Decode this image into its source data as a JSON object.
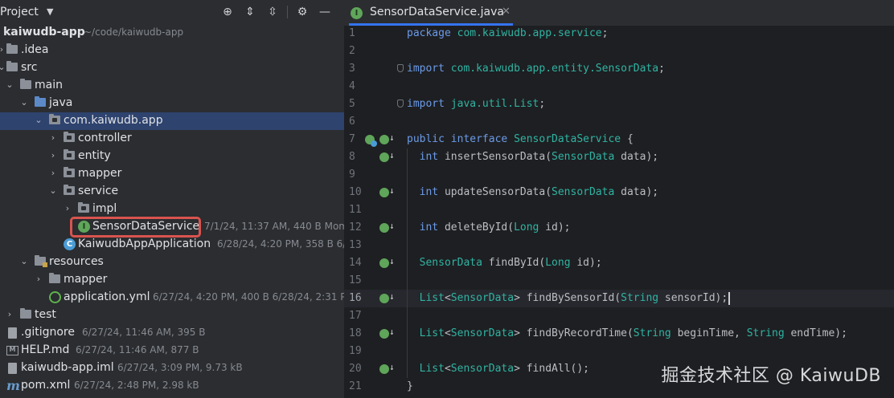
{
  "project_panel": {
    "title": "Project",
    "tree": [
      {
        "name": "kaiwudb-app",
        "meta": "~/code/kaiwudb-app"
      },
      {
        "name": ".idea"
      },
      {
        "name": "src"
      },
      {
        "name": "main"
      },
      {
        "name": "java"
      },
      {
        "name": "com.kaiwudb.app"
      },
      {
        "name": "controller"
      },
      {
        "name": "entity"
      },
      {
        "name": "mapper"
      },
      {
        "name": "service"
      },
      {
        "name": "impl"
      },
      {
        "name": "SensorDataService",
        "meta": "7/1/24, 11:37 AM, 440 B Mome"
      },
      {
        "name": "KaiwudbAppApplication",
        "meta": "6/28/24, 4:20 PM, 358 B 6/2"
      },
      {
        "name": "resources"
      },
      {
        "name": "mapper"
      },
      {
        "name": "application.yml",
        "meta": "6/27/24, 4:20 PM, 400 B 6/28/24, 2:31 PM"
      },
      {
        "name": "test"
      },
      {
        "name": ".gitignore",
        "meta": "6/27/24, 11:46 AM, 395 B"
      },
      {
        "name": "HELP.md",
        "meta": "6/27/24, 11:46 AM, 877 B"
      },
      {
        "name": "kaiwudb-app.iml",
        "meta": "6/27/24, 3:09 PM, 9.73 kB"
      },
      {
        "name": "pom.xml",
        "meta": "6/27/24, 2:48 PM, 2.98 kB"
      }
    ]
  },
  "editor": {
    "tab_label": "SensorDataService.java",
    "current_line": 16,
    "lines": [
      {
        "n": "1",
        "tokens": [
          [
            "kw",
            "package "
          ],
          [
            "ty",
            "com.kaiwudb.app.service"
          ],
          [
            "pl",
            ";"
          ]
        ]
      },
      {
        "n": "2",
        "tokens": []
      },
      {
        "n": "3",
        "tokens": [
          [
            "kw",
            "import "
          ],
          [
            "ty",
            "com.kaiwudb.app.entity.SensorData"
          ],
          [
            "pl",
            ";"
          ]
        ]
      },
      {
        "n": "4",
        "tokens": []
      },
      {
        "n": "5",
        "tokens": [
          [
            "kw",
            "import "
          ],
          [
            "ty",
            "java.util.List"
          ],
          [
            "pl",
            ";"
          ]
        ]
      },
      {
        "n": "6",
        "tokens": []
      },
      {
        "n": "7",
        "tokens": [
          [
            "kw",
            "public interface "
          ],
          [
            "ty",
            "SensorDataService"
          ],
          [
            "pl",
            " {"
          ]
        ]
      },
      {
        "n": "8",
        "tokens": [
          [
            "pl",
            "  "
          ],
          [
            "kw",
            "int "
          ],
          [
            "pl",
            "insertSensorData("
          ],
          [
            "ty",
            "SensorData"
          ],
          [
            "pl",
            " data);"
          ]
        ]
      },
      {
        "n": "9",
        "tokens": []
      },
      {
        "n": "10",
        "tokens": [
          [
            "pl",
            "  "
          ],
          [
            "kw",
            "int "
          ],
          [
            "pl",
            "updateSensorData("
          ],
          [
            "ty",
            "SensorData"
          ],
          [
            "pl",
            " data);"
          ]
        ]
      },
      {
        "n": "11",
        "tokens": []
      },
      {
        "n": "12",
        "tokens": [
          [
            "pl",
            "  "
          ],
          [
            "kw",
            "int "
          ],
          [
            "pl",
            "deleteById("
          ],
          [
            "ty",
            "Long"
          ],
          [
            "pl",
            " id);"
          ]
        ]
      },
      {
        "n": "13",
        "tokens": []
      },
      {
        "n": "14",
        "tokens": [
          [
            "pl",
            "  "
          ],
          [
            "ty",
            "SensorData"
          ],
          [
            "pl",
            " findById("
          ],
          [
            "ty",
            "Long"
          ],
          [
            "pl",
            " id);"
          ]
        ]
      },
      {
        "n": "15",
        "tokens": []
      },
      {
        "n": "16",
        "tokens": [
          [
            "pl",
            "  "
          ],
          [
            "ty",
            "List"
          ],
          [
            "pl",
            "<"
          ],
          [
            "ty",
            "SensorData"
          ],
          [
            "pl",
            "> findBySensorId("
          ],
          [
            "ty",
            "String"
          ],
          [
            "pl",
            " sensorId);"
          ]
        ]
      },
      {
        "n": "17",
        "tokens": []
      },
      {
        "n": "18",
        "tokens": [
          [
            "pl",
            "  "
          ],
          [
            "ty",
            "List"
          ],
          [
            "pl",
            "<"
          ],
          [
            "ty",
            "SensorData"
          ],
          [
            "pl",
            "> findByRecordTime("
          ],
          [
            "ty",
            "String"
          ],
          [
            "pl",
            " beginTime, "
          ],
          [
            "ty",
            "String"
          ],
          [
            "pl",
            " endTime);"
          ]
        ]
      },
      {
        "n": "19",
        "tokens": []
      },
      {
        "n": "20",
        "tokens": [
          [
            "pl",
            "  "
          ],
          [
            "ty",
            "List"
          ],
          [
            "pl",
            "<"
          ],
          [
            "ty",
            "SensorData"
          ],
          [
            "pl",
            "> findAll();"
          ]
        ]
      },
      {
        "n": "21",
        "tokens": [
          [
            "pl",
            "}"
          ]
        ]
      }
    ]
  },
  "watermark": "掘金技术社区 @ KaiwuDB",
  "colors": {
    "panel_bg": "#2b2d30",
    "editor_bg": "#1e1f22",
    "keyword": "#6b9be8",
    "type": "#2fb4a3",
    "accent": "#3574f0",
    "highlight_box": "#d9534f"
  }
}
